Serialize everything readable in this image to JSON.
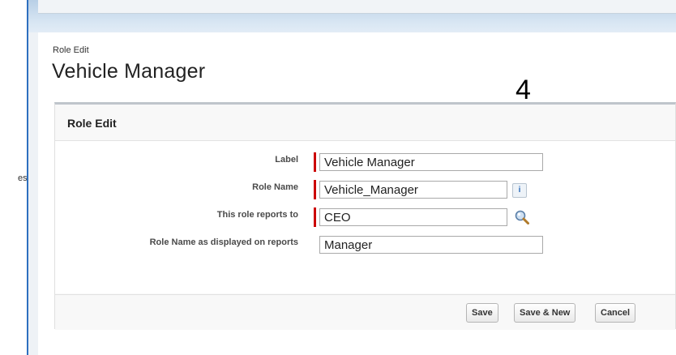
{
  "left_nav": {
    "cut_text": "es"
  },
  "page": {
    "subtitle": "Role Edit",
    "title": "Vehicle Manager",
    "annotation_number": "4"
  },
  "panel": {
    "title": "Role Edit",
    "fields": {
      "label": {
        "label": "Label",
        "value": "Vehicle Manager",
        "required": true
      },
      "role_name": {
        "label": "Role Name",
        "value": "Vehicle_Manager",
        "required": true,
        "icon": "info-icon"
      },
      "reports_to": {
        "label": "This role reports to",
        "value": "CEO",
        "required": true,
        "icon": "lookup-icon"
      },
      "display_name": {
        "label": "Role Name as displayed on reports",
        "value": "Manager",
        "required": false
      }
    },
    "buttons": {
      "save": "Save",
      "save_new": "Save & New",
      "cancel": "Cancel"
    }
  },
  "colors": {
    "required_marker": "#cc0000",
    "left_edge": "#2e6fbf",
    "top_band": "#c8d9ec"
  }
}
